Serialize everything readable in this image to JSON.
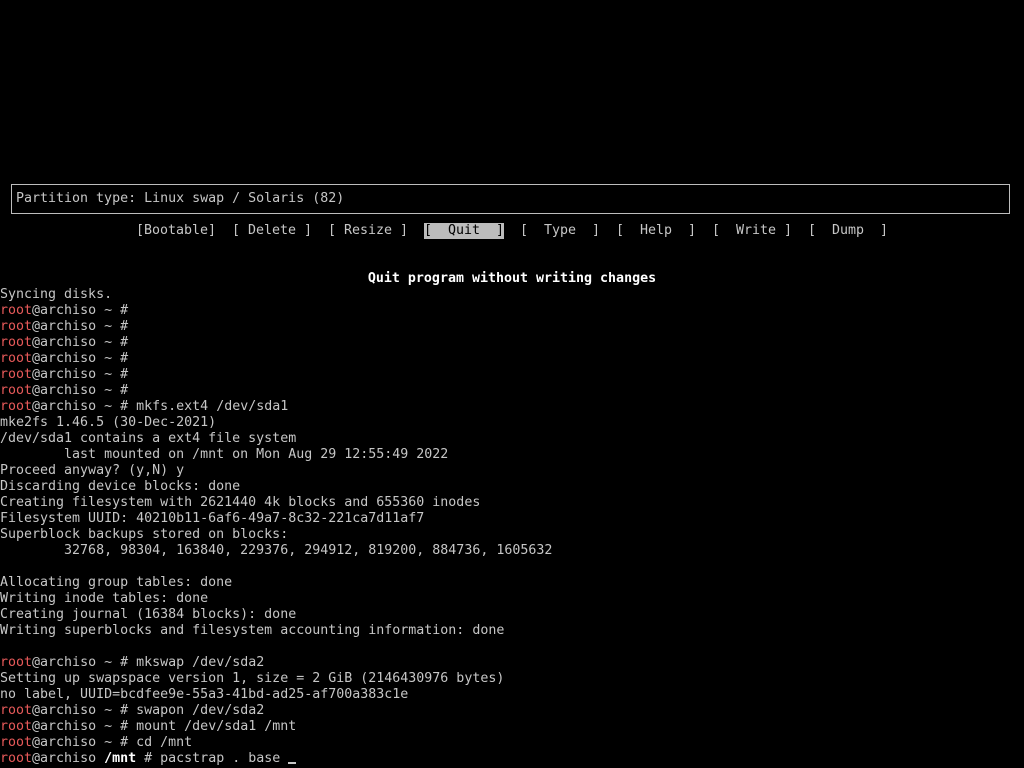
{
  "partition_type": "Partition type: Linux swap / Solaris (82)",
  "menu": [
    {
      "label": "[Bootable]",
      "selected": false
    },
    {
      "label": "[ Delete ]",
      "selected": false
    },
    {
      "label": "[ Resize ]",
      "selected": false
    },
    {
      "label": "[  Quit  ]",
      "selected": true
    },
    {
      "label": "[  Type  ]",
      "selected": false
    },
    {
      "label": "[  Help  ]",
      "selected": false
    },
    {
      "label": "[  Write ]",
      "selected": false
    },
    {
      "label": "[  Dump  ]",
      "selected": false
    }
  ],
  "status_message": "Quit program without writing changes",
  "colors": {
    "background": "#000000",
    "text": "#c6c6c6",
    "prompt_user": "#e85a5a",
    "selected_bg": "#bcbcbc"
  },
  "terminal_lines": [
    {
      "prompt": false,
      "text": "Syncing disks."
    },
    {
      "prompt": true,
      "user": "root",
      "host": "@archiso",
      "dir": "~",
      "dir_bold": false,
      "cmd": ""
    },
    {
      "prompt": true,
      "user": "root",
      "host": "@archiso",
      "dir": "~",
      "dir_bold": false,
      "cmd": ""
    },
    {
      "prompt": true,
      "user": "root",
      "host": "@archiso",
      "dir": "~",
      "dir_bold": false,
      "cmd": ""
    },
    {
      "prompt": true,
      "user": "root",
      "host": "@archiso",
      "dir": "~",
      "dir_bold": false,
      "cmd": ""
    },
    {
      "prompt": true,
      "user": "root",
      "host": "@archiso",
      "dir": "~",
      "dir_bold": false,
      "cmd": ""
    },
    {
      "prompt": true,
      "user": "root",
      "host": "@archiso",
      "dir": "~",
      "dir_bold": false,
      "cmd": ""
    },
    {
      "prompt": true,
      "user": "root",
      "host": "@archiso",
      "dir": "~",
      "dir_bold": false,
      "cmd": "mkfs.ext4 /dev/sda1"
    },
    {
      "prompt": false,
      "text": "mke2fs 1.46.5 (30-Dec-2021)"
    },
    {
      "prompt": false,
      "text": "/dev/sda1 contains a ext4 file system"
    },
    {
      "prompt": false,
      "text": "        last mounted on /mnt on Mon Aug 29 12:55:49 2022"
    },
    {
      "prompt": false,
      "text": "Proceed anyway? (y,N) y"
    },
    {
      "prompt": false,
      "text": "Discarding device blocks: done"
    },
    {
      "prompt": false,
      "text": "Creating filesystem with 2621440 4k blocks and 655360 inodes"
    },
    {
      "prompt": false,
      "text": "Filesystem UUID: 40210b11-6af6-49a7-8c32-221ca7d11af7"
    },
    {
      "prompt": false,
      "text": "Superblock backups stored on blocks:"
    },
    {
      "prompt": false,
      "text": "        32768, 98304, 163840, 229376, 294912, 819200, 884736, 1605632"
    },
    {
      "prompt": false,
      "text": ""
    },
    {
      "prompt": false,
      "text": "Allocating group tables: done"
    },
    {
      "prompt": false,
      "text": "Writing inode tables: done"
    },
    {
      "prompt": false,
      "text": "Creating journal (16384 blocks): done"
    },
    {
      "prompt": false,
      "text": "Writing superblocks and filesystem accounting information: done"
    },
    {
      "prompt": false,
      "text": ""
    },
    {
      "prompt": true,
      "user": "root",
      "host": "@archiso",
      "dir": "~",
      "dir_bold": false,
      "cmd": "mkswap /dev/sda2"
    },
    {
      "prompt": false,
      "text": "Setting up swapspace version 1, size = 2 GiB (2146430976 bytes)"
    },
    {
      "prompt": false,
      "text": "no label, UUID=bcdfee9e-55a3-41bd-ad25-af700a383c1e"
    },
    {
      "prompt": true,
      "user": "root",
      "host": "@archiso",
      "dir": "~",
      "dir_bold": false,
      "cmd": "swapon /dev/sda2"
    },
    {
      "prompt": true,
      "user": "root",
      "host": "@archiso",
      "dir": "~",
      "dir_bold": false,
      "cmd": "mount /dev/sda1 /mnt"
    },
    {
      "prompt": true,
      "user": "root",
      "host": "@archiso",
      "dir": "~",
      "dir_bold": false,
      "cmd": "cd /mnt"
    },
    {
      "prompt": true,
      "user": "root",
      "host": "@archiso",
      "dir": "/mnt",
      "dir_bold": true,
      "cmd": "pacstrap . base",
      "cursor": true
    }
  ]
}
